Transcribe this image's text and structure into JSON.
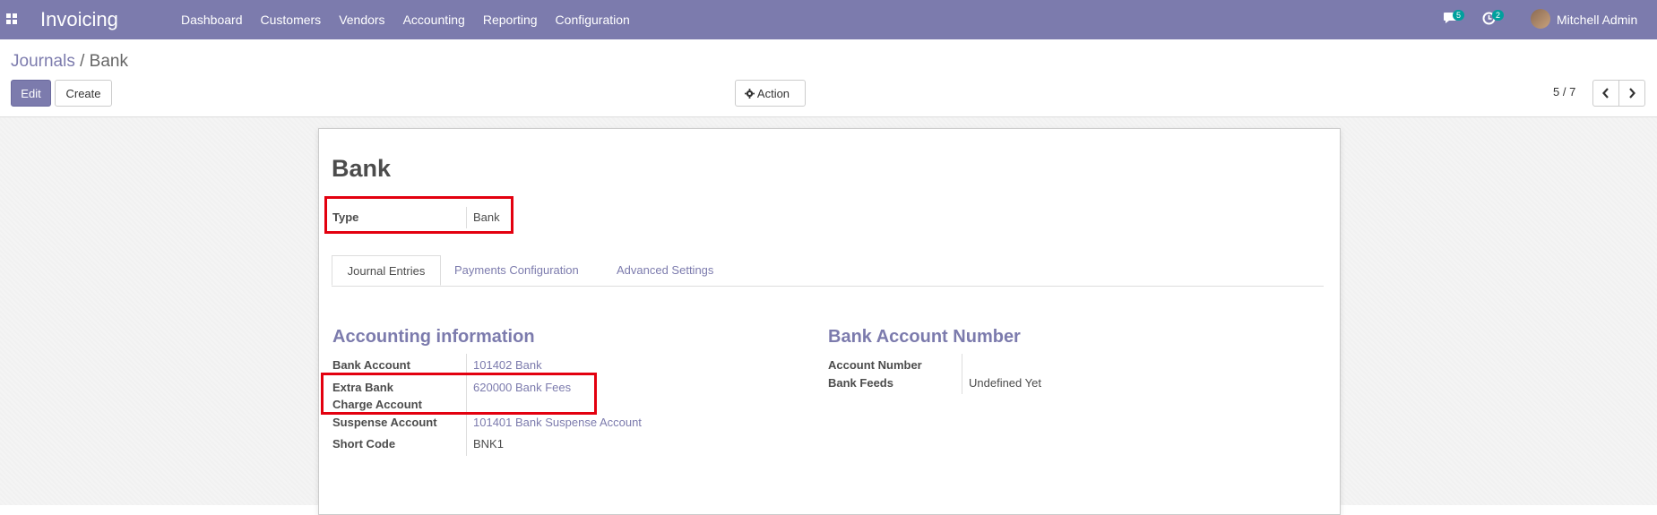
{
  "navbar": {
    "app_title": "Invoicing",
    "menu": [
      "Dashboard",
      "Customers",
      "Vendors",
      "Accounting",
      "Reporting",
      "Configuration"
    ],
    "messages_count": "5",
    "activities_count": "2",
    "user_name": "Mitchell Admin"
  },
  "breadcrumb": {
    "parent": "Journals",
    "separator": "/",
    "current": "Bank"
  },
  "toolbar": {
    "edit": "Edit",
    "create": "Create",
    "action": "Action",
    "pager": "5 / 7"
  },
  "form": {
    "title": "Bank",
    "type_label": "Type",
    "type_value": "Bank",
    "tabs": [
      "Journal Entries",
      "Payments Configuration",
      "Advanced Settings"
    ],
    "accounting_section": "Accounting information",
    "bank_account_label": "Bank Account",
    "bank_account_value": "101402 Bank",
    "extra_label_line1": "Extra Bank",
    "extra_label_line2": "Charge Account",
    "extra_value": "620000 Bank Fees",
    "suspense_label": "Suspense Account",
    "suspense_value": "101401 Bank Suspense Account",
    "short_code_label": "Short Code",
    "short_code_value": "BNK1",
    "bank_section": "Bank Account Number",
    "account_number_label": "Account Number",
    "bank_feeds_label": "Bank Feeds",
    "bank_feeds_value": "Undefined Yet"
  },
  "colors": {
    "brand": "#7c7bad",
    "highlight": "#e3000f",
    "badge": "#00a09d"
  }
}
